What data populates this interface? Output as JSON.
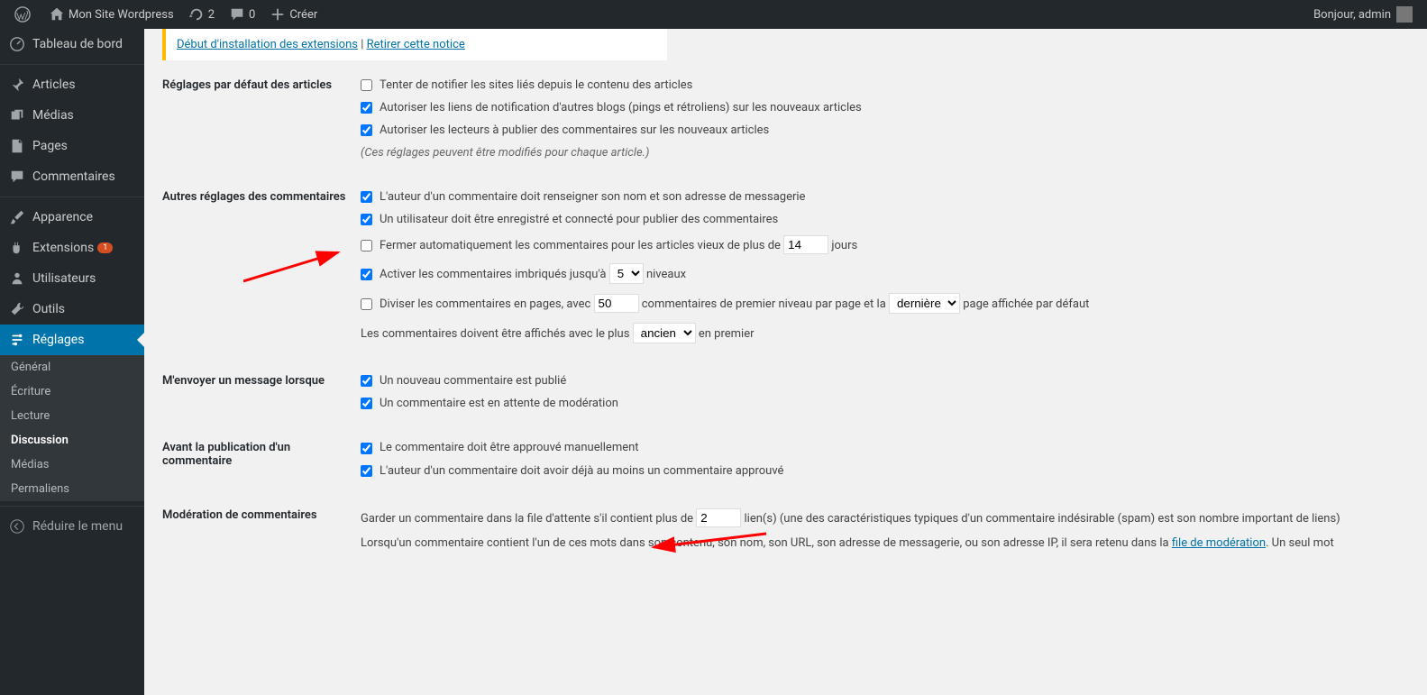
{
  "adminbar": {
    "site_name": "Mon Site Wordpress",
    "updates": "2",
    "comments": "0",
    "create": "Créer",
    "howdy": "Bonjour, admin"
  },
  "sidebar": {
    "dashboard": "Tableau de bord",
    "posts": "Articles",
    "media": "Médias",
    "pages": "Pages",
    "comments": "Commentaires",
    "appearance": "Apparence",
    "plugins": "Extensions",
    "plugins_badge": "1",
    "users": "Utilisateurs",
    "tools": "Outils",
    "settings": "Réglages",
    "sub": {
      "general": "Général",
      "writing": "Écriture",
      "reading": "Lecture",
      "discussion": "Discussion",
      "medias": "Médias",
      "permalinks": "Permaliens"
    },
    "collapse": "Réduire le menu"
  },
  "notice": {
    "install": "Début d'installation des extensions",
    "sep": " | ",
    "dismiss": "Retirer cette notice"
  },
  "sections": {
    "defaults": {
      "title": "Réglages par défaut des articles",
      "opt1": "Tenter de notifier les sites liés depuis le contenu des articles",
      "opt2": "Autoriser les liens de notification d'autres blogs (pings et rétroliens) sur les nouveaux articles",
      "opt3": "Autoriser les lecteurs à publier des commentaires sur les nouveaux articles",
      "hint": "(Ces réglages peuvent être modifiés pour chaque article.)"
    },
    "other": {
      "title": "Autres réglages des commentaires",
      "opt1": "L'auteur d'un commentaire doit renseigner son nom et son adresse de messagerie",
      "opt2": "Un utilisateur doit être enregistré et connecté pour publier des commentaires",
      "opt3a": "Fermer automatiquement les commentaires pour les articles vieux de plus de ",
      "days_val": "14",
      "opt3b": " jours",
      "opt4a": "Activer les commentaires imbriqués jusqu'à ",
      "levels_val": "5",
      "opt4b": " niveaux",
      "opt5a": "Diviser les commentaires en pages, avec ",
      "perpage_val": "50",
      "opt5b": " commentaires de premier niveau par page et la ",
      "page_sel": "dernière",
      "opt5c": " page affichée par défaut",
      "opt6a": "Les commentaires doivent être affichés avec le plus ",
      "order_sel": "ancien",
      "opt6b": " en premier"
    },
    "email": {
      "title": "M'envoyer un message lorsque",
      "opt1": "Un nouveau commentaire est publié",
      "opt2": "Un commentaire est en attente de modération"
    },
    "before": {
      "title": "Avant la publication d'un commentaire",
      "opt1": "Le commentaire doit être approuvé manuellement",
      "opt2": "L'auteur d'un commentaire doit avoir déjà au moins un commentaire approuvé"
    },
    "moderation": {
      "title": "Modération de commentaires",
      "text1": "Garder un commentaire dans la file d'attente s'il contient plus de ",
      "links_val": "2",
      "text2": " lien(s) (une des caractéristiques typiques d'un commentaire indésirable (spam) est son nombre important de liens)",
      "text3a": "Lorsqu'un commentaire contient l'un de ces mots dans son contenu, son nom, son URL, son adresse de messagerie, ou son adresse IP, il sera retenu dans la ",
      "text3link": "file de modération",
      "text3b": ". Un seul mot"
    }
  }
}
